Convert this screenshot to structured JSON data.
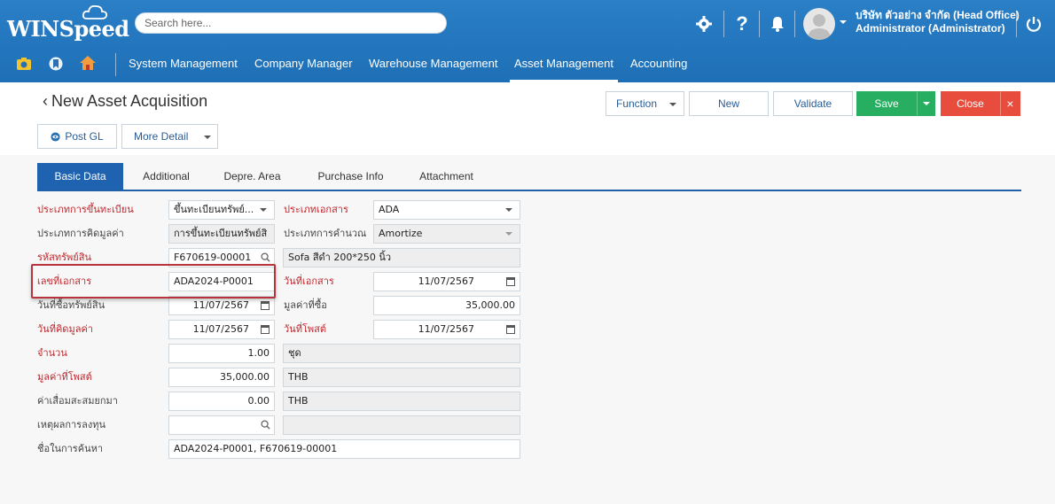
{
  "app": {
    "logo": "WINSpeed"
  },
  "search": {
    "placeholder": "Search here..."
  },
  "user": {
    "company": "บริษัท ตัวอย่าง จำกัด (Head Office)",
    "role": "Administrator (Administrator)"
  },
  "menu": [
    "System Management",
    "Company Manager",
    "Warehouse Management",
    "Asset Management",
    "Accounting"
  ],
  "page": {
    "title": "New Asset Acquisition"
  },
  "actions": {
    "function": "Function",
    "new": "New",
    "validate": "Validate",
    "save": "Save",
    "close": "Close",
    "post_gl": "Post GL",
    "more_detail": "More Detail"
  },
  "tabs": [
    "Basic Data",
    "Additional",
    "Depre. Area",
    "Purchase Info",
    "Attachment"
  ],
  "form": {
    "reg_type": {
      "label": "ประเภทการขึ้นทะเบียน",
      "value": "ขึ้นทะเบียนทรัพย์..."
    },
    "doc_type": {
      "label": "ประเภทเอกสาร",
      "value": "ADA"
    },
    "valuation_type": {
      "label": "ประเภทการคิดมูลค่า",
      "value": "การขึ้นทะเบียนทรัพย์สิ"
    },
    "calc_type": {
      "label": "ประเภทการคำนวณ",
      "value": "Amortize"
    },
    "asset_code": {
      "label": "รหัสทรัพย์สิน",
      "value": "F670619-00001",
      "name": "Sofa สีดำ 200*250 นิ้ว"
    },
    "doc_no": {
      "label": "เลขที่เอกสาร",
      "value": "ADA2024-P0001"
    },
    "doc_date": {
      "label": "วันที่เอกสาร",
      "value": "11/07/2567"
    },
    "purchase_date": {
      "label": "วันที่ซื้อทรัพย์สิน",
      "value": "11/07/2567"
    },
    "purchase_value": {
      "label": "มูลค่าที่ซื้อ",
      "value": "35,000.00"
    },
    "valuation_date": {
      "label": "วันที่คิดมูลค่า",
      "value": "11/07/2567"
    },
    "post_date": {
      "label": "วันที่โพสต์",
      "value": "11/07/2567"
    },
    "quantity": {
      "label": "จำนวน",
      "value": "1.00",
      "unit": "ชุด"
    },
    "post_value": {
      "label": "มูลค่าที่โพสต์",
      "value": "35,000.00",
      "currency": "THB"
    },
    "accum_depr": {
      "label": "ค่าเสื่อมสะสมยกมา",
      "value": "0.00",
      "currency": "THB"
    },
    "invest_reason": {
      "label": "เหตุผลการลงทุน",
      "value": ""
    },
    "search_name": {
      "label": "ชื่อในการค้นหา",
      "value": "ADA2024-P0001, F670619-00001"
    }
  },
  "colors": {
    "header": "#1e6fb6",
    "save": "#27ae60",
    "close": "#e74c3c",
    "required": "#c1272d",
    "highlight": "#b8333a"
  }
}
